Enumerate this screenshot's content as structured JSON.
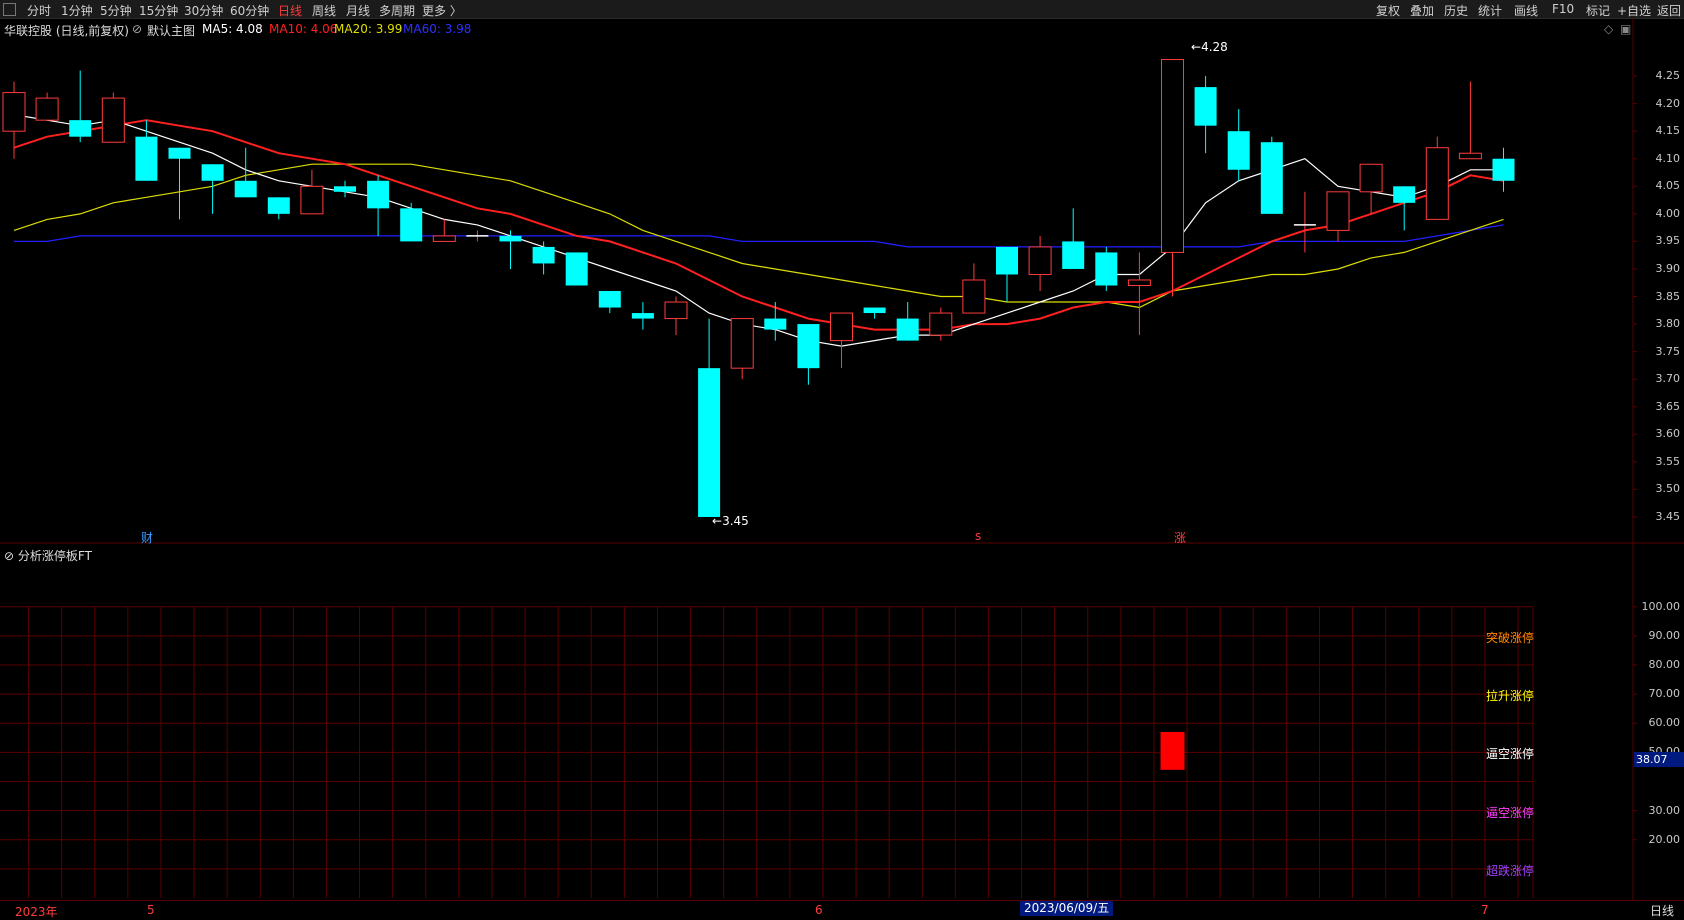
{
  "toolbar": {
    "left": [
      "分时",
      "1分钟",
      "5分钟",
      "15分钟",
      "30分钟",
      "60分钟",
      "日线",
      "周线",
      "月线",
      "多周期",
      "更多 〉"
    ],
    "active": "日线",
    "right": [
      "复权",
      "叠加",
      "历史",
      "统计",
      "画线",
      "F10",
      "+自选",
      "返回"
    ],
    "right_extra": "标记"
  },
  "legend": {
    "title": "华联控股 (日线,前复权)",
    "template": "默认主图",
    "ma5": "MA5: 4.08",
    "ma10": "MA10: 4.06",
    "ma20": "MA20: 3.99",
    "ma60": "MA60: 3.98"
  },
  "colors": {
    "up": "#ff3b3b",
    "down": "#00ffff",
    "ma5": "#ffffff",
    "ma10": "#ff2020",
    "ma20": "#dddd00",
    "ma60": "#2020ff",
    "grid": "#5a0000"
  },
  "price_axis": [
    "4.25",
    "4.20",
    "4.15",
    "4.10",
    "4.05",
    "4.00",
    "3.95",
    "3.90",
    "3.85",
    "3.80",
    "3.75",
    "3.70",
    "3.65",
    "3.60",
    "3.55",
    "3.50",
    "3.45"
  ],
  "annotations": {
    "high": "4.28",
    "low": "3.45"
  },
  "events": {
    "cai": "财",
    "s": "s",
    "zhang": "涨"
  },
  "indicator": {
    "title": "分析涨停板FT",
    "axis": [
      "100.00",
      "90.00",
      "80.00",
      "70.00",
      "60.00",
      "50.00",
      "30.00",
      "20.00"
    ],
    "levels": [
      {
        "label": "突破涨停",
        "color": "#ff8c00"
      },
      {
        "label": "拉升涨停",
        "color": "#ffff00"
      },
      {
        "label": "逼空涨停",
        "color": "#ffffff"
      },
      {
        "label": "逼空涨停",
        "color": "#ff40ff"
      },
      {
        "label": "超跌涨停",
        "color": "#a040ff"
      }
    ],
    "current_value": "38.07",
    "bar_value": 50
  },
  "dates": {
    "year": "2023年",
    "m5": "5",
    "m6": "6",
    "m7": "7",
    "selected": "2023/06/09/五",
    "period": "日线"
  },
  "chart_data": {
    "type": "candlestick",
    "ylim": [
      3.43,
      4.31
    ],
    "candles": [
      {
        "o": 4.15,
        "h": 4.24,
        "l": 4.1,
        "c": 4.22
      },
      {
        "o": 4.17,
        "h": 4.22,
        "l": 4.17,
        "c": 4.21
      },
      {
        "o": 4.17,
        "h": 4.26,
        "l": 4.13,
        "c": 4.14
      },
      {
        "o": 4.13,
        "h": 4.22,
        "l": 4.13,
        "c": 4.21
      },
      {
        "o": 4.14,
        "h": 4.17,
        "l": 4.06,
        "c": 4.06
      },
      {
        "o": 4.12,
        "h": 4.12,
        "l": 3.99,
        "c": 4.1
      },
      {
        "o": 4.09,
        "h": 4.09,
        "l": 4.0,
        "c": 4.06
      },
      {
        "o": 4.06,
        "h": 4.12,
        "l": 4.03,
        "c": 4.03
      },
      {
        "o": 4.03,
        "h": 4.03,
        "l": 3.99,
        "c": 4.0
      },
      {
        "o": 4.0,
        "h": 4.08,
        "l": 4.0,
        "c": 4.05
      },
      {
        "o": 4.05,
        "h": 4.06,
        "l": 4.03,
        "c": 4.04
      },
      {
        "o": 4.06,
        "h": 4.07,
        "l": 3.96,
        "c": 4.01
      },
      {
        "o": 4.01,
        "h": 4.02,
        "l": 3.95,
        "c": 3.95
      },
      {
        "o": 3.95,
        "h": 3.99,
        "l": 3.95,
        "c": 3.96
      },
      {
        "o": 3.96,
        "h": 3.97,
        "l": 3.95,
        "c": 3.96
      },
      {
        "o": 3.96,
        "h": 3.97,
        "l": 3.9,
        "c": 3.95
      },
      {
        "o": 3.94,
        "h": 3.95,
        "l": 3.89,
        "c": 3.91
      },
      {
        "o": 3.93,
        "h": 3.93,
        "l": 3.87,
        "c": 3.87
      },
      {
        "o": 3.86,
        "h": 3.86,
        "l": 3.82,
        "c": 3.83
      },
      {
        "o": 3.82,
        "h": 3.84,
        "l": 3.79,
        "c": 3.81
      },
      {
        "o": 3.81,
        "h": 3.85,
        "l": 3.78,
        "c": 3.84
      },
      {
        "o": 3.72,
        "h": 3.81,
        "l": 3.45,
        "c": 3.45
      },
      {
        "o": 3.72,
        "h": 3.81,
        "l": 3.7,
        "c": 3.81
      },
      {
        "o": 3.81,
        "h": 3.84,
        "l": 3.77,
        "c": 3.79
      },
      {
        "o": 3.8,
        "h": 3.8,
        "l": 3.69,
        "c": 3.72
      },
      {
        "o": 3.77,
        "h": 3.82,
        "l": 3.72,
        "c": 3.82
      },
      {
        "o": 3.83,
        "h": 3.83,
        "l": 3.81,
        "c": 3.82
      },
      {
        "o": 3.81,
        "h": 3.84,
        "l": 3.77,
        "c": 3.77
      },
      {
        "o": 3.78,
        "h": 3.83,
        "l": 3.77,
        "c": 3.82
      },
      {
        "o": 3.82,
        "h": 3.91,
        "l": 3.82,
        "c": 3.88
      },
      {
        "o": 3.94,
        "h": 3.94,
        "l": 3.84,
        "c": 3.89
      },
      {
        "o": 3.89,
        "h": 3.96,
        "l": 3.86,
        "c": 3.94
      },
      {
        "o": 3.95,
        "h": 4.01,
        "l": 3.9,
        "c": 3.9
      },
      {
        "o": 3.93,
        "h": 3.94,
        "l": 3.86,
        "c": 3.87
      },
      {
        "o": 3.87,
        "h": 3.93,
        "l": 3.78,
        "c": 3.88
      },
      {
        "o": 3.93,
        "h": 4.28,
        "l": 3.85,
        "c": 4.28
      },
      {
        "o": 4.23,
        "h": 4.25,
        "l": 4.11,
        "c": 4.16
      },
      {
        "o": 4.15,
        "h": 4.19,
        "l": 4.06,
        "c": 4.08
      },
      {
        "o": 4.13,
        "h": 4.14,
        "l": 4.0,
        "c": 4.0
      },
      {
        "o": 3.98,
        "h": 4.04,
        "l": 3.93,
        "c": 3.98
      },
      {
        "o": 3.97,
        "h": 4.04,
        "l": 3.95,
        "c": 4.04
      },
      {
        "o": 4.04,
        "h": 4.09,
        "l": 4.0,
        "c": 4.09
      },
      {
        "o": 4.05,
        "h": 4.05,
        "l": 3.97,
        "c": 4.02
      },
      {
        "o": 3.99,
        "h": 4.14,
        "l": 3.99,
        "c": 4.12
      },
      {
        "o": 4.1,
        "h": 4.24,
        "l": 4.1,
        "c": 4.11
      },
      {
        "o": 4.1,
        "h": 4.12,
        "l": 4.04,
        "c": 4.06
      }
    ],
    "ma5": [
      4.18,
      4.17,
      4.16,
      4.17,
      4.15,
      4.13,
      4.11,
      4.08,
      4.06,
      4.05,
      4.04,
      4.03,
      4.01,
      3.99,
      3.98,
      3.96,
      3.94,
      3.92,
      3.9,
      3.88,
      3.86,
      3.82,
      3.8,
      3.79,
      3.77,
      3.76,
      3.77,
      3.78,
      3.78,
      3.8,
      3.82,
      3.84,
      3.86,
      3.89,
      3.89,
      3.94,
      4.02,
      4.06,
      4.08,
      4.1,
      4.05,
      4.04,
      4.03,
      4.05,
      4.08,
      4.08
    ],
    "ma10": [
      4.12,
      4.14,
      4.15,
      4.16,
      4.17,
      4.16,
      4.15,
      4.13,
      4.11,
      4.1,
      4.09,
      4.07,
      4.05,
      4.03,
      4.01,
      4.0,
      3.98,
      3.96,
      3.95,
      3.93,
      3.91,
      3.88,
      3.85,
      3.83,
      3.81,
      3.8,
      3.79,
      3.79,
      3.79,
      3.8,
      3.8,
      3.81,
      3.83,
      3.84,
      3.84,
      3.86,
      3.89,
      3.92,
      3.95,
      3.97,
      3.98,
      4.0,
      4.02,
      4.04,
      4.07,
      4.06
    ],
    "ma20": [
      3.97,
      3.99,
      4.0,
      4.02,
      4.03,
      4.04,
      4.05,
      4.07,
      4.08,
      4.09,
      4.09,
      4.09,
      4.09,
      4.08,
      4.07,
      4.06,
      4.04,
      4.02,
      4.0,
      3.97,
      3.95,
      3.93,
      3.91,
      3.9,
      3.89,
      3.88,
      3.87,
      3.86,
      3.85,
      3.85,
      3.84,
      3.84,
      3.84,
      3.84,
      3.83,
      3.86,
      3.87,
      3.88,
      3.89,
      3.89,
      3.9,
      3.92,
      3.93,
      3.95,
      3.97,
      3.99
    ],
    "ma60": [
      3.95,
      3.95,
      3.96,
      3.96,
      3.96,
      3.96,
      3.96,
      3.96,
      3.96,
      3.96,
      3.96,
      3.96,
      3.96,
      3.96,
      3.96,
      3.96,
      3.96,
      3.96,
      3.96,
      3.96,
      3.96,
      3.96,
      3.95,
      3.95,
      3.95,
      3.95,
      3.95,
      3.94,
      3.94,
      3.94,
      3.94,
      3.94,
      3.94,
      3.94,
      3.94,
      3.94,
      3.94,
      3.94,
      3.95,
      3.95,
      3.95,
      3.95,
      3.95,
      3.96,
      3.97,
      3.98
    ]
  }
}
